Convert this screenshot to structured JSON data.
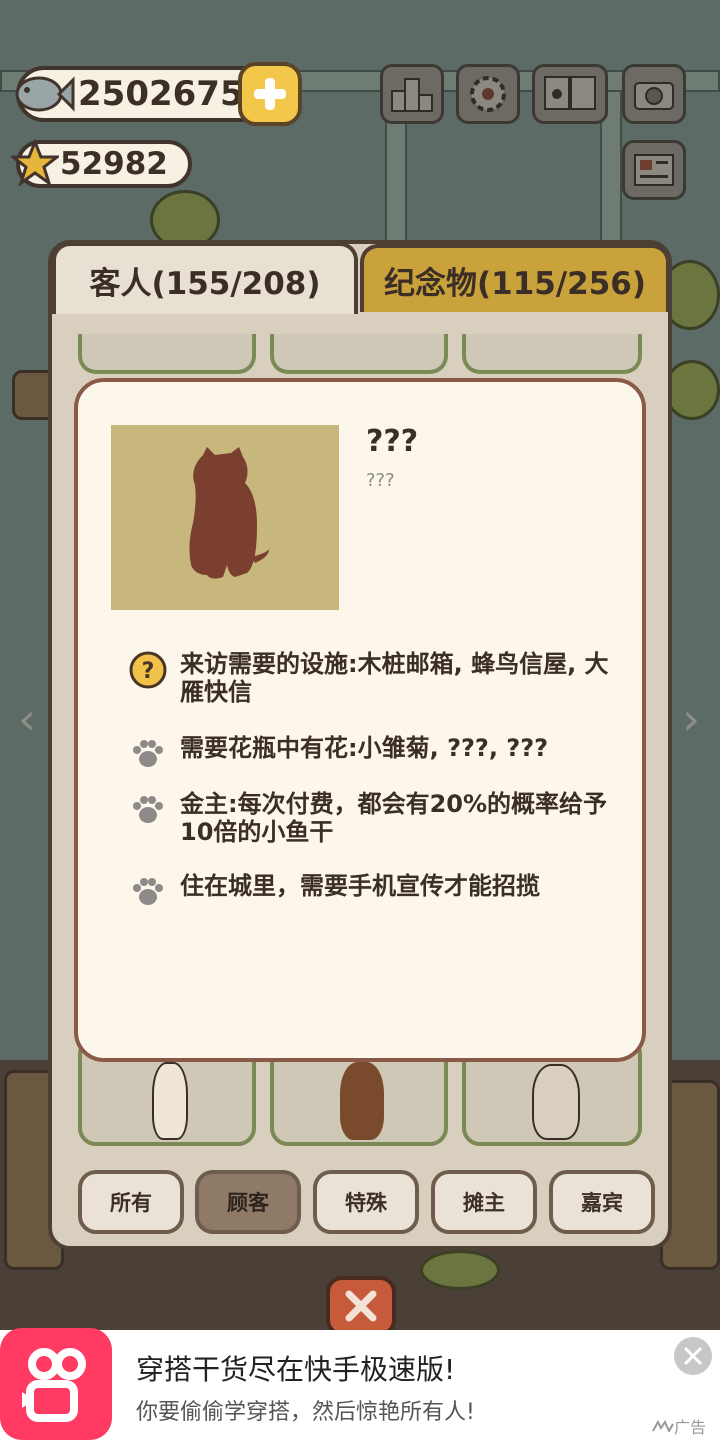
{
  "hud": {
    "fish_count": "25026755",
    "star_count": "52982",
    "icons": [
      "fish-icon",
      "star-icon",
      "plus-icon",
      "leaderboard-icon",
      "settings-gear-icon",
      "paw-book-icon",
      "camera-icon",
      "newspaper-icon"
    ]
  },
  "tabs": {
    "guests": "客人(155/208)",
    "souvenirs": "纪念物(115/256)"
  },
  "detail": {
    "name": "???",
    "subtitle": "???",
    "requirements": [
      {
        "icon": "question-icon",
        "text": "来访需要的设施:木桩邮箱, 蜂鸟信屋, 大雁快信"
      },
      {
        "icon": "paw-icon",
        "text": "需要花瓶中有花:小雏菊, ???, ???"
      },
      {
        "icon": "paw-icon",
        "text": "金主:每次付费，都会有20%的概率给予10倍的小鱼干"
      },
      {
        "icon": "paw-icon",
        "text": "住在城里，需要手机宣传才能招揽"
      }
    ]
  },
  "filters": [
    {
      "label": "所有",
      "active": false
    },
    {
      "label": "顾客",
      "active": true
    },
    {
      "label": "特殊",
      "active": false
    },
    {
      "label": "摊主",
      "active": false
    },
    {
      "label": "嘉宾",
      "active": false
    }
  ],
  "ad": {
    "title": "穿搭干货尽在快手极速版!",
    "subtitle": "你要偷偷学穿搭，然后惊艳所有人!",
    "mark": "广告"
  },
  "colors": {
    "panel": "#d9cfbf",
    "tab_active": "#e8e0d2",
    "tab_inactive": "#caa23c",
    "card": "#fdf6ea",
    "portrait_bg": "#c8b77d",
    "silhouette": "#7a3f2e",
    "ad_brand": "#ff3a63"
  }
}
